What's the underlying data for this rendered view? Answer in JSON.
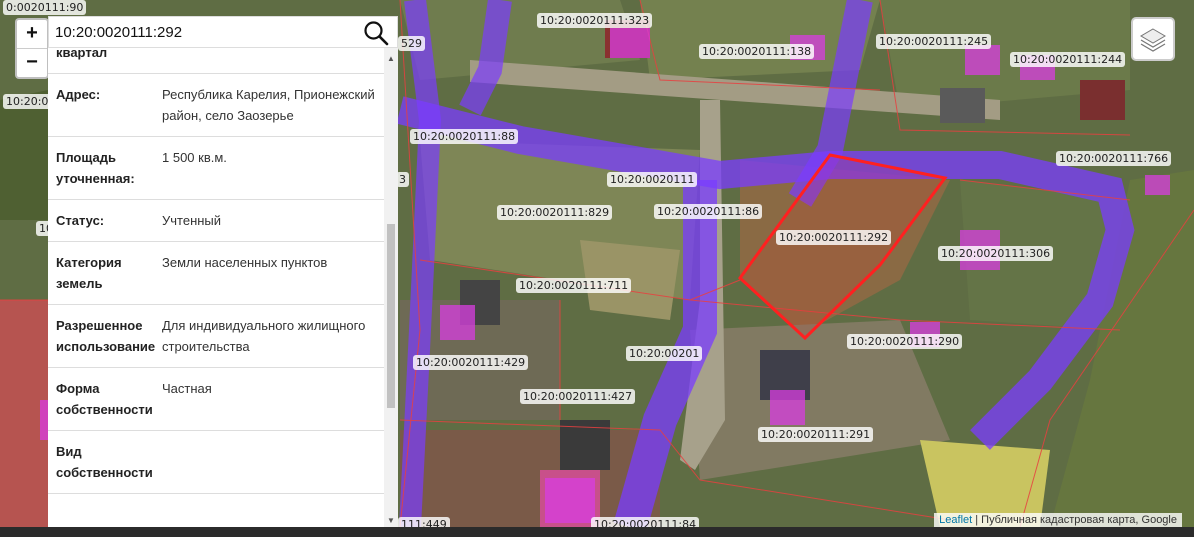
{
  "search": {
    "value": "10:20:0020111:292"
  },
  "zoom": {
    "in_label": "+",
    "out_label": "−"
  },
  "info_rows": [
    {
      "key": "квартал",
      "value": ""
    },
    {
      "key": "Адрес:",
      "value": "Республика Карелия, Прионежский район, село Заозерье"
    },
    {
      "key": "Площадь уточненная:",
      "value": "1 500 кв.м."
    },
    {
      "key": "Статус:",
      "value": "Учтенный"
    },
    {
      "key": "Категория земель",
      "value": "Земли населенных пунктов"
    },
    {
      "key": "Разрешенное использование",
      "value": "Для индивидуального жилищного строительства"
    },
    {
      "key": "Форма собственности",
      "value": "Частная"
    },
    {
      "key": "Вид собственности",
      "value": ""
    }
  ],
  "map_labels": [
    "10:20:0020111:323",
    "10:20:0020111:138",
    "10:20:0020111:245",
    "10:20:0020111:244",
    "10:20:0020111:88",
    "10:20:0020111:766",
    "10:20:0020111",
    "10:20:0020111:829",
    "10:20:0020111:86",
    "10:20:0020111:292",
    "10:20:0020111:306",
    "10:20:0020111:711",
    "10:20:0020111:290",
    "10:20:00201",
    "10:20:0020111:429",
    "10:20:0020111:427",
    "10:20:0020111:291",
    "529",
    "0:0020111:90",
    "10:20:00",
    "10",
    "3",
    "111:449",
    "10:20:0020111:84"
  ],
  "attribution": {
    "link": "Leaflet",
    "text": " | Публичная кадастровая карта, Google"
  },
  "colors": {
    "highlight": "#ff2020",
    "route": "#7a3cff",
    "parcel_line": "#e84040"
  }
}
